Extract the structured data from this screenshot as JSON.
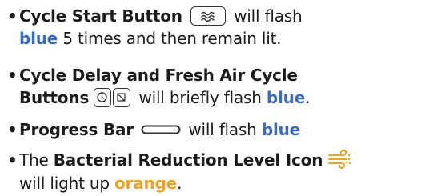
{
  "bullet": "•",
  "items": [
    {
      "lines": [
        {
          "b": "Cycle Start Button",
          "after": "will flash"
        },
        {
          "blue": "blue",
          "rest": "5 times and then remain lit."
        }
      ]
    },
    {
      "lines": [
        {
          "b": "Cycle Delay and Fresh Air Cycle"
        },
        {
          "b": "Buttons",
          "after": "will briefly flash ",
          "blue": "blue",
          "rest": "."
        }
      ]
    },
    {
      "lines": [
        {
          "b": "Progress Bar",
          "after": "will flash ",
          "blue": "blue"
        }
      ]
    },
    {
      "lines": [
        {
          "pre": "The ",
          "b": "Bacterial Reduction Level Icon"
        },
        {
          "pre": "will light up ",
          "orange": "orange",
          "rest": "."
        }
      ]
    }
  ],
  "colors": {
    "blue": "#3a6bc2",
    "orange": "#f2a21d"
  },
  "icons": [
    "cycle-start-waves-icon",
    "cycle-delay-clock-icon",
    "fresh-air-icon",
    "progress-bar-icon",
    "bacterial-reduction-icon"
  ]
}
